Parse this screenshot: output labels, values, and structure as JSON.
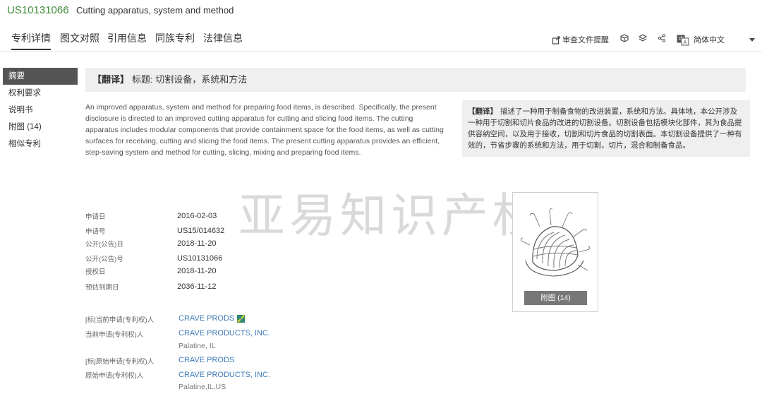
{
  "header": {
    "pub_no": "US10131066",
    "title": "Cutting apparatus, system and method"
  },
  "tabs": [
    {
      "label": "专利详情",
      "active": true
    },
    {
      "label": "图文对照",
      "active": false
    },
    {
      "label": "引用信息",
      "active": false
    },
    {
      "label": "同族专利",
      "active": false
    },
    {
      "label": "法律信息",
      "active": false
    }
  ],
  "toolbar": {
    "review_label": "审查文件提醒",
    "language_label": "简体中文"
  },
  "sidebar": {
    "items": [
      {
        "label": "摘要",
        "active": true
      },
      {
        "label": "权利要求",
        "active": false
      },
      {
        "label": "说明书",
        "active": false
      },
      {
        "label": "附图 (14)",
        "active": false
      },
      {
        "label": "相似专利",
        "active": false
      }
    ]
  },
  "translation": {
    "tag": "【翻译】",
    "title_text": "标题: 切割设备，系统和方法"
  },
  "abstract": {
    "en": "An improved apparatus, system and method for preparing food items, is described. Specifically, the present disclosure is directed to an improved cutting apparatus for cutting and slicing food items. The cutting apparatus includes modular components that provide containment space for the food items, as well as cutting surfaces for receiving, cutting and slicing the food items. The present cutting apparatus provides an efficient, step-saving system and method for cutting, slicing, mixing and preparing food items.",
    "zh_tag": "【翻译】",
    "zh": "描述了一种用于制备食物的改进装置，系统和方法。具体地，本公开涉及一种用于切割和切片食品的改进的切割设备。切割设备包括模块化部件，其为食品提供容纳空间，以及用于接收，切割和切片食品的切割表面。本切割设备提供了一种有效的，节省步骤的系统和方法，用于切割，切片，混合和制备食品。"
  },
  "watermark": "亚易知识产权",
  "fields": {
    "app_date": {
      "label": "申请日",
      "value": "2016-02-03"
    },
    "app_no": {
      "label": "申请号",
      "value": "US15/014632"
    },
    "pub_date": {
      "label": "公开(公告)日",
      "value": "2018-11-20"
    },
    "pub_no": {
      "label": "公开(公告)号",
      "value": "US10131066"
    },
    "grant_date": {
      "label": "授权日",
      "value": "2018-11-20"
    },
    "expiry": {
      "label": "预估到期日",
      "value": "2036-11-12"
    }
  },
  "applicants": {
    "std_current": {
      "label": "[标]当前申请(专利权)人",
      "value": "CRAVE PRODS"
    },
    "current": {
      "label": "当前申请(专利权)人",
      "value": "CRAVE PRODUCTS, INC.",
      "location": "Palatine, IL"
    },
    "std_original": {
      "label": "[标]原始申请(专利权)人",
      "value": "CRAVE PRODS"
    },
    "original": {
      "label": "原始申请(专利权)人",
      "value": "CRAVE PRODUCTS, INC.",
      "location": "Palatine,IL,US"
    }
  },
  "figure": {
    "button_label": "附图 (14)"
  }
}
